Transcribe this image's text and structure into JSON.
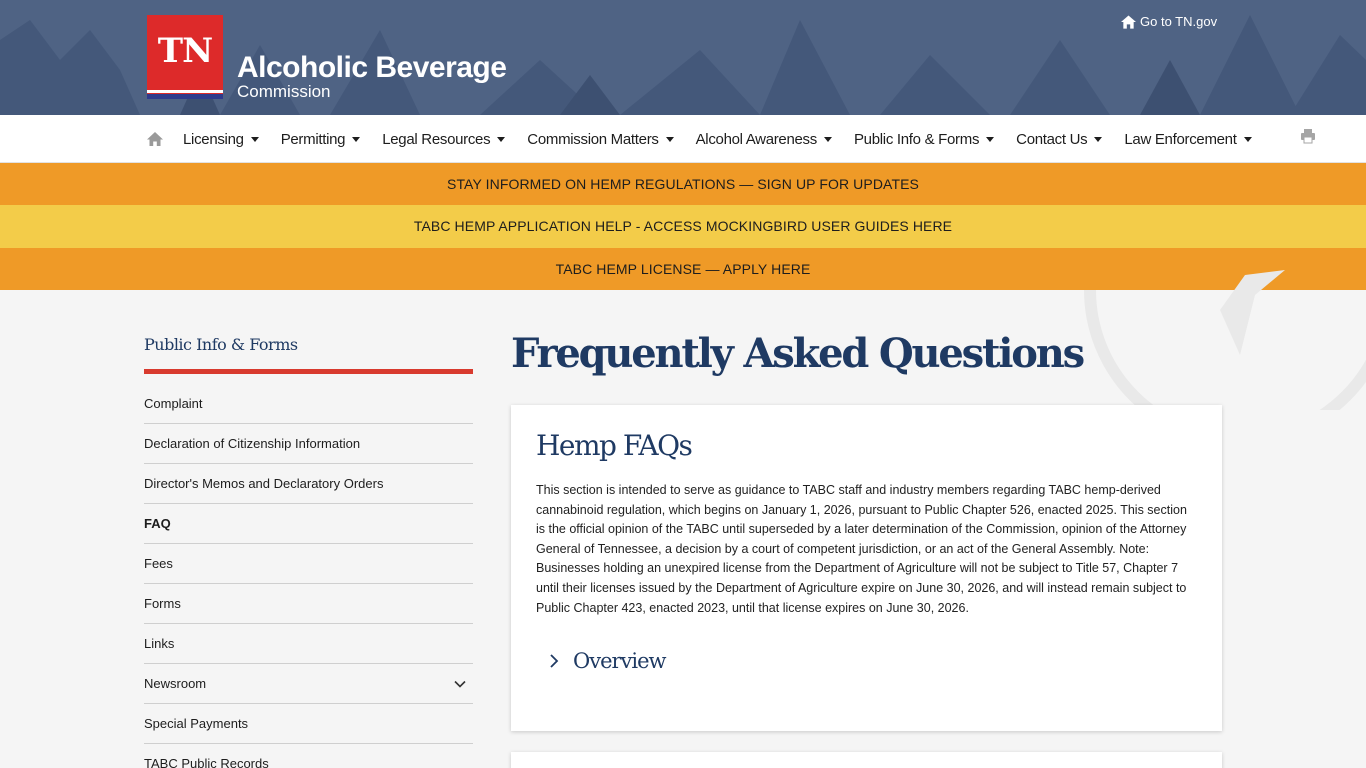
{
  "header": {
    "logo_mark": "TN",
    "agency_line1": "Alcoholic Beverage",
    "agency_line2": "Commission",
    "go_tn_label": "Go to TN.gov"
  },
  "nav": {
    "items": [
      {
        "label": "Licensing"
      },
      {
        "label": "Permitting"
      },
      {
        "label": "Legal Resources"
      },
      {
        "label": "Commission Matters"
      },
      {
        "label": "Alcohol Awareness"
      },
      {
        "label": "Public Info & Forms"
      },
      {
        "label": "Contact Us"
      },
      {
        "label": "Law Enforcement"
      }
    ]
  },
  "banners": [
    {
      "text": "STAY INFORMED ON HEMP REGULATIONS — SIGN UP FOR UPDATES",
      "color": "#ef9a27"
    },
    {
      "text": "TABC HEMP APPLICATION HELP - ACCESS MOCKINGBIRD USER GUIDES HERE",
      "color": "#f3cc49"
    },
    {
      "text": "TABC HEMP LICENSE — APPLY HERE",
      "color": "#ef9a27"
    }
  ],
  "sidebar": {
    "title": "Public Info & Forms",
    "items": [
      {
        "label": "Complaint"
      },
      {
        "label": "Declaration of Citizenship Information"
      },
      {
        "label": "Director's Memos and Declaratory Orders"
      },
      {
        "label": "FAQ"
      },
      {
        "label": "Fees"
      },
      {
        "label": "Forms"
      },
      {
        "label": "Links"
      },
      {
        "label": "Newsroom"
      },
      {
        "label": "Special Payments"
      },
      {
        "label": "TABC Public Records"
      }
    ]
  },
  "main": {
    "title": "Frequently Asked Questions",
    "card": {
      "heading": "Hemp FAQs",
      "body": "This section is intended to serve as guidance to TABC staff and industry members regarding TABC hemp-derived cannabinoid regulation, which begins on January 1, 2026, pursuant to Public Chapter 526, enacted 2025. This section is the official opinion of the TABC until superseded by a later determination of the Commission, opinion of the Attorney General of Tennessee, a decision by a court of competent jurisdiction, or an act of the General Assembly. Note: Businesses holding an unexpired license from the Department of Agriculture will not be subject to Title 57, Chapter 7 until their licenses issued by the Department of Agriculture expire on June 30, 2026, and will instead remain subject to Public Chapter 423, enacted 2023, until that license expires on June 30, 2026.",
      "accordion_label": "Overview"
    }
  },
  "colors": {
    "brand_red": "#dd2a2a",
    "navy": "#1f3a63",
    "header_bg": "#4f6384",
    "banner_orange": "#ef9a27",
    "banner_yellow": "#f3cc49",
    "sidebar_rule": "#d83a2e"
  }
}
